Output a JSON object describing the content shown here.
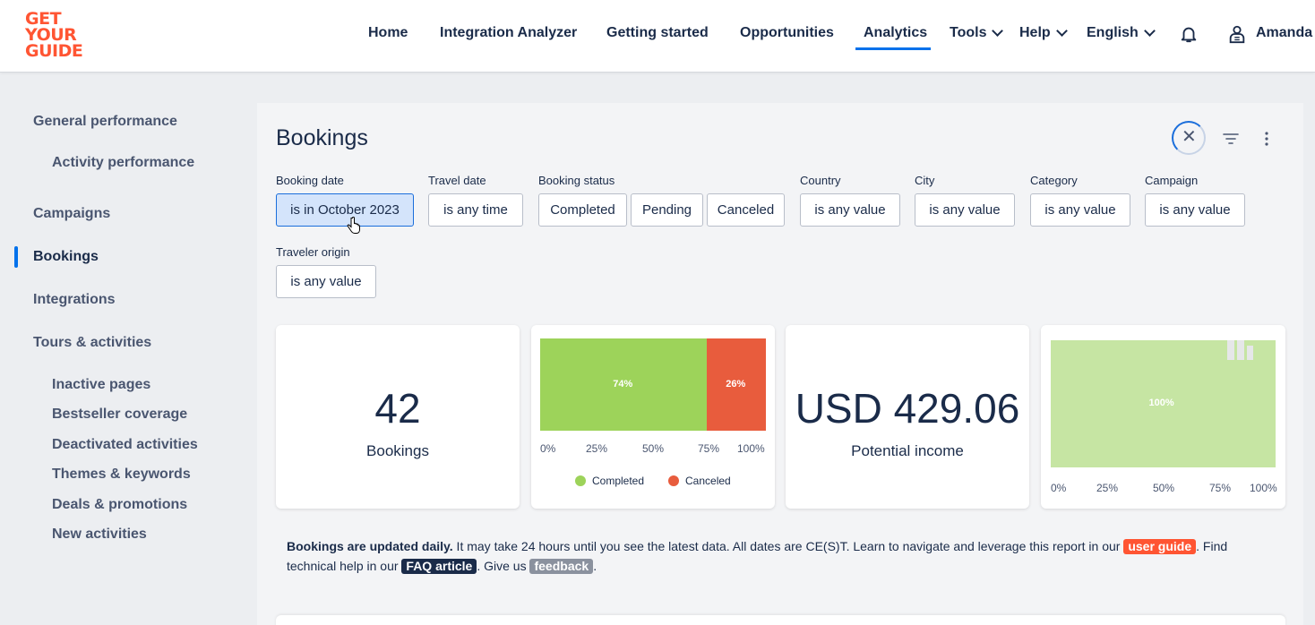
{
  "logo": {
    "line1": "GET",
    "line2": "YOUR",
    "line3": "GUIDE"
  },
  "nav": {
    "home": "Home",
    "integration_analyzer": "Integration Analyzer",
    "getting_started": "Getting started",
    "opportunities": "Opportunities",
    "analytics": "Analytics",
    "tools": "Tools",
    "help": "Help",
    "language": "English",
    "user": "Amanda"
  },
  "sidebar": {
    "general_performance": "General performance",
    "activity_performance": "Activity performance",
    "campaigns": "Campaigns",
    "bookings": "Bookings",
    "integrations": "Integrations",
    "tours_activities": "Tours & activities",
    "inactive_pages": "Inactive pages",
    "bestseller_coverage": "Bestseller coverage",
    "deactivated_activities": "Deactivated activities",
    "themes_keywords": "Themes & keywords",
    "deals_promotions": "Deals & promotions",
    "new_activities": "New activities"
  },
  "page": {
    "title": "Bookings"
  },
  "filters": {
    "booking_date": {
      "label": "Booking date",
      "value": "is in October 2023"
    },
    "travel_date": {
      "label": "Travel date",
      "value": "is any time"
    },
    "booking_status": {
      "label": "Booking status",
      "completed": "Completed",
      "pending": "Pending",
      "canceled": "Canceled"
    },
    "country": {
      "label": "Country",
      "value": "is any value"
    },
    "city": {
      "label": "City",
      "value": "is any value"
    },
    "category": {
      "label": "Category",
      "value": "is any value"
    },
    "campaign": {
      "label": "Campaign",
      "value": "is any value"
    },
    "traveler_origin": {
      "label": "Traveler origin",
      "value": "is any value"
    }
  },
  "kpi": {
    "bookings_value": "42",
    "bookings_label": "Bookings",
    "income_value": "USD 429.06",
    "income_label": "Potential income"
  },
  "chart_data": [
    {
      "type": "bar",
      "orientation": "horizontal-stacked",
      "series": [
        {
          "name": "Completed",
          "values": [
            74
          ],
          "color": "#9dd35a"
        },
        {
          "name": "Canceled",
          "values": [
            26
          ],
          "color": "#e85c3d"
        }
      ],
      "data_labels": [
        "74%",
        "26%"
      ],
      "x_ticks": [
        "0%",
        "25%",
        "50%",
        "75%",
        "100%"
      ],
      "xlim": [
        0,
        100
      ],
      "legend": "bottom"
    },
    {
      "type": "bar",
      "orientation": "horizontal-stacked",
      "series": [
        {
          "values": [
            100
          ],
          "color": "#c6e5a3"
        }
      ],
      "data_labels": [
        "100%"
      ],
      "x_ticks": [
        "0%",
        "25%",
        "50%",
        "75%",
        "100%"
      ],
      "xlim": [
        0,
        100
      ]
    }
  ],
  "note": {
    "bold": "Bookings are updated daily.",
    "text1": " It may take 24 hours until you see the latest data. All dates are CE(S)T. Learn to navigate and leverage this report in our ",
    "user_guide": "user guide",
    "text2": ". Find technical help in our ",
    "faq": "FAQ article",
    "text3": ". Give us ",
    "feedback": "feedback",
    "text4": "."
  },
  "colors": {
    "brand": "#ff5533",
    "accent": "#0071eb",
    "completed": "#9dd35a",
    "canceled": "#e85c3d"
  }
}
